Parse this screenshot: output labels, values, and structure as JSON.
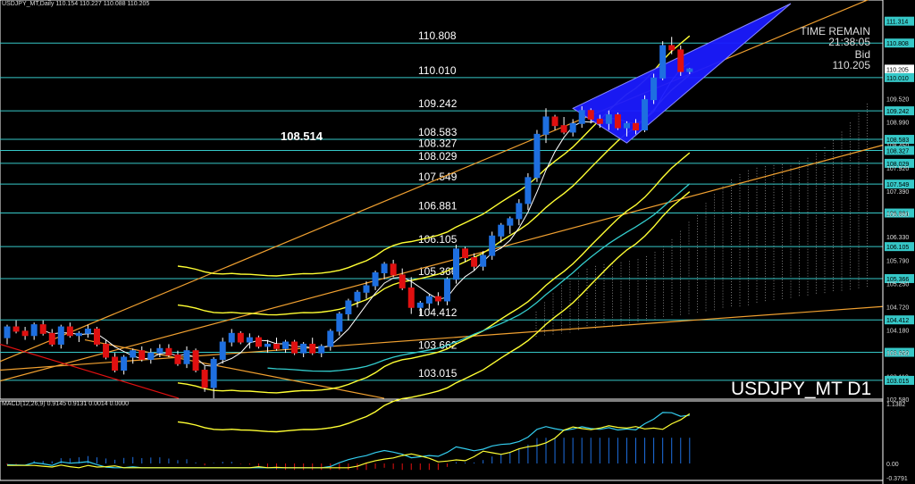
{
  "header": {
    "title": "USDJPY_MT,Daily",
    "ohlc": "110.154 110.227 110.088 110.205"
  },
  "symbol_label": "USDJPY_MT D1",
  "time_remain": {
    "label": "TIME REMAIN",
    "value": "21:38:05",
    "bid_label": "Bid",
    "bid_value": "110.205"
  },
  "pivot_label": "108.514",
  "macd_header": "MACD(12,26,9) 0.9145 0.9131 0.0014 0.0000",
  "colors": {
    "background": "#000000",
    "bull_candle": "#1e6fe0",
    "bear_candle": "#e01010",
    "bollinger": "#ffff33",
    "level_line": "#36c8c8",
    "trendline": "#f0a030",
    "triangle": "#1a1aff",
    "macd_line": "#33ccee",
    "signal_line": "#ffff33"
  },
  "chart_data": {
    "type": "candlestick",
    "symbol": "USDJPY_MT",
    "timeframe": "D1",
    "ylim": [
      102.58,
      111.72
    ],
    "y_axis_ticks": [
      "111.314",
      "110.808",
      "110.205",
      "110.010",
      "109.520",
      "109.242",
      "108.990",
      "108.583",
      "108.450",
      "108.327",
      "108.029",
      "107.920",
      "107.549",
      "107.390",
      "106.881",
      "106.860",
      "106.330",
      "106.105",
      "105.790",
      "105.366",
      "105.250",
      "104.720",
      "104.412",
      "104.180",
      "103.662",
      "103.650",
      "103.110",
      "103.015",
      "102.580"
    ],
    "levels": [
      {
        "value": 110.808,
        "label": "110.808"
      },
      {
        "value": 110.01,
        "label": "110.010"
      },
      {
        "value": 109.242,
        "label": "109.242"
      },
      {
        "value": 108.583,
        "label": "108.583"
      },
      {
        "value": 108.327,
        "label": "108.327"
      },
      {
        "value": 108.029,
        "label": "108.029"
      },
      {
        "value": 107.549,
        "label": "107.549"
      },
      {
        "value": 106.881,
        "label": "106.881"
      },
      {
        "value": 106.105,
        "label": "106.105"
      },
      {
        "value": 105.366,
        "label": "105.366"
      },
      {
        "value": 104.412,
        "label": "104.412"
      },
      {
        "value": 103.662,
        "label": "103.662"
      },
      {
        "value": 103.015,
        "label": "103.015"
      }
    ],
    "extra_axis_labels": [
      "111.314"
    ],
    "candles": [
      {
        "o": 104.0,
        "h": 104.3,
        "l": 103.85,
        "c": 104.25
      },
      {
        "o": 104.25,
        "h": 104.4,
        "l": 104.1,
        "c": 104.15
      },
      {
        "o": 104.15,
        "h": 104.25,
        "l": 103.95,
        "c": 104.05
      },
      {
        "o": 104.05,
        "h": 104.35,
        "l": 103.95,
        "c": 104.3
      },
      {
        "o": 104.3,
        "h": 104.4,
        "l": 104.05,
        "c": 104.1
      },
      {
        "o": 104.1,
        "h": 104.2,
        "l": 103.8,
        "c": 103.85
      },
      {
        "o": 103.85,
        "h": 104.3,
        "l": 103.75,
        "c": 104.25
      },
      {
        "o": 104.25,
        "h": 104.35,
        "l": 104.0,
        "c": 104.05
      },
      {
        "o": 104.05,
        "h": 104.15,
        "l": 103.9,
        "c": 104.1
      },
      {
        "o": 104.1,
        "h": 104.3,
        "l": 104.0,
        "c": 104.2
      },
      {
        "o": 104.2,
        "h": 104.25,
        "l": 103.8,
        "c": 103.85
      },
      {
        "o": 103.85,
        "h": 103.95,
        "l": 103.5,
        "c": 103.55
      },
      {
        "o": 103.55,
        "h": 103.65,
        "l": 103.2,
        "c": 103.25
      },
      {
        "o": 103.25,
        "h": 103.6,
        "l": 103.15,
        "c": 103.55
      },
      {
        "o": 103.55,
        "h": 103.75,
        "l": 103.4,
        "c": 103.7
      },
      {
        "o": 103.7,
        "h": 103.8,
        "l": 103.45,
        "c": 103.5
      },
      {
        "o": 103.5,
        "h": 103.75,
        "l": 103.4,
        "c": 103.65
      },
      {
        "o": 103.65,
        "h": 103.85,
        "l": 103.55,
        "c": 103.75
      },
      {
        "o": 103.75,
        "h": 103.85,
        "l": 103.55,
        "c": 103.6
      },
      {
        "o": 103.6,
        "h": 103.7,
        "l": 103.35,
        "c": 103.4
      },
      {
        "o": 103.4,
        "h": 103.8,
        "l": 103.3,
        "c": 103.7
      },
      {
        "o": 103.7,
        "h": 103.75,
        "l": 103.2,
        "c": 103.25
      },
      {
        "o": 103.25,
        "h": 103.35,
        "l": 102.75,
        "c": 102.85
      },
      {
        "o": 102.85,
        "h": 103.55,
        "l": 102.6,
        "c": 103.5
      },
      {
        "o": 103.5,
        "h": 104.0,
        "l": 103.4,
        "c": 103.9
      },
      {
        "o": 103.9,
        "h": 104.2,
        "l": 103.8,
        "c": 104.1
      },
      {
        "o": 104.1,
        "h": 104.15,
        "l": 103.85,
        "c": 103.9
      },
      {
        "o": 103.9,
        "h": 104.1,
        "l": 103.75,
        "c": 104.0
      },
      {
        "o": 104.0,
        "h": 104.05,
        "l": 103.75,
        "c": 103.8
      },
      {
        "o": 103.8,
        "h": 103.95,
        "l": 103.65,
        "c": 103.85
      },
      {
        "o": 103.85,
        "h": 104.0,
        "l": 103.7,
        "c": 103.75
      },
      {
        "o": 103.75,
        "h": 103.95,
        "l": 103.65,
        "c": 103.9
      },
      {
        "o": 103.9,
        "h": 103.95,
        "l": 103.6,
        "c": 103.65
      },
      {
        "o": 103.65,
        "h": 103.9,
        "l": 103.55,
        "c": 103.85
      },
      {
        "o": 103.85,
        "h": 104.0,
        "l": 103.6,
        "c": 103.65
      },
      {
        "o": 103.65,
        "h": 103.85,
        "l": 103.55,
        "c": 103.8
      },
      {
        "o": 103.8,
        "h": 104.2,
        "l": 103.7,
        "c": 104.15
      },
      {
        "o": 104.15,
        "h": 104.6,
        "l": 104.05,
        "c": 104.55
      },
      {
        "o": 104.55,
        "h": 104.9,
        "l": 104.4,
        "c": 104.85
      },
      {
        "o": 104.85,
        "h": 105.1,
        "l": 104.7,
        "c": 105.05
      },
      {
        "o": 105.05,
        "h": 105.3,
        "l": 104.9,
        "c": 105.2
      },
      {
        "o": 105.2,
        "h": 105.55,
        "l": 105.1,
        "c": 105.5
      },
      {
        "o": 105.5,
        "h": 105.75,
        "l": 105.35,
        "c": 105.7
      },
      {
        "o": 105.7,
        "h": 105.8,
        "l": 105.4,
        "c": 105.45
      },
      {
        "o": 105.45,
        "h": 105.6,
        "l": 105.1,
        "c": 105.15
      },
      {
        "o": 105.15,
        "h": 105.4,
        "l": 104.55,
        "c": 104.7
      },
      {
        "o": 104.7,
        "h": 104.85,
        "l": 104.5,
        "c": 104.8
      },
      {
        "o": 104.8,
        "h": 105.0,
        "l": 104.65,
        "c": 104.95
      },
      {
        "o": 104.95,
        "h": 105.05,
        "l": 104.75,
        "c": 104.85
      },
      {
        "o": 104.85,
        "h": 105.4,
        "l": 104.75,
        "c": 105.35
      },
      {
        "o": 105.35,
        "h": 106.15,
        "l": 105.25,
        "c": 106.05
      },
      {
        "o": 106.05,
        "h": 106.1,
        "l": 105.75,
        "c": 105.85
      },
      {
        "o": 105.85,
        "h": 105.95,
        "l": 105.55,
        "c": 105.65
      },
      {
        "o": 105.65,
        "h": 106.0,
        "l": 105.55,
        "c": 105.9
      },
      {
        "o": 105.9,
        "h": 106.45,
        "l": 105.8,
        "c": 106.35
      },
      {
        "o": 106.35,
        "h": 106.65,
        "l": 106.2,
        "c": 106.6
      },
      {
        "o": 106.6,
        "h": 106.8,
        "l": 106.4,
        "c": 106.75
      },
      {
        "o": 106.75,
        "h": 107.2,
        "l": 106.6,
        "c": 107.1
      },
      {
        "o": 107.1,
        "h": 107.8,
        "l": 106.95,
        "c": 107.7
      },
      {
        "o": 107.7,
        "h": 108.8,
        "l": 107.6,
        "c": 108.7
      },
      {
        "o": 108.7,
        "h": 109.3,
        "l": 108.5,
        "c": 109.1
      },
      {
        "o": 109.1,
        "h": 109.15,
        "l": 108.8,
        "c": 108.9
      },
      {
        "o": 108.9,
        "h": 109.1,
        "l": 108.7,
        "c": 108.75
      },
      {
        "o": 108.75,
        "h": 109.05,
        "l": 108.65,
        "c": 108.95
      },
      {
        "o": 108.95,
        "h": 109.35,
        "l": 108.85,
        "c": 109.25
      },
      {
        "o": 109.25,
        "h": 109.3,
        "l": 108.95,
        "c": 109.05
      },
      {
        "o": 109.05,
        "h": 109.15,
        "l": 108.85,
        "c": 108.95
      },
      {
        "o": 108.95,
        "h": 109.25,
        "l": 108.8,
        "c": 109.15
      },
      {
        "o": 109.15,
        "h": 109.2,
        "l": 108.8,
        "c": 108.85
      },
      {
        "o": 108.85,
        "h": 109.0,
        "l": 108.65,
        "c": 108.95
      },
      {
        "o": 108.95,
        "h": 109.05,
        "l": 108.7,
        "c": 108.8
      },
      {
        "o": 108.8,
        "h": 109.6,
        "l": 108.75,
        "c": 109.5
      },
      {
        "o": 109.5,
        "h": 110.1,
        "l": 109.4,
        "c": 110.0
      },
      {
        "o": 110.0,
        "h": 110.85,
        "l": 109.95,
        "c": 110.75
      },
      {
        "o": 110.75,
        "h": 110.95,
        "l": 110.55,
        "c": 110.65
      },
      {
        "o": 110.65,
        "h": 110.75,
        "l": 110.05,
        "c": 110.15
      },
      {
        "o": 110.15,
        "h": 110.23,
        "l": 110.09,
        "c": 110.21
      }
    ],
    "current_price": 110.205,
    "macd": {
      "name": "MACD(12,26,9)",
      "main": 0.9145,
      "signal": 0.9131,
      "ylim_labels": [
        "1.1382",
        "0.00",
        "-0.3791"
      ]
    }
  }
}
